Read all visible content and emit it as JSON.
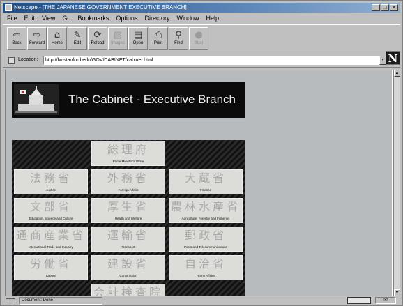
{
  "window": {
    "title": "Netscape - [THE JAPANESE GOVERNMENT EXECUTIVE BRANCH]",
    "controls": {
      "minimize": "_",
      "maximize": "□",
      "close": "×"
    }
  },
  "menu": [
    "File",
    "Edit",
    "View",
    "Go",
    "Bookmarks",
    "Options",
    "Directory",
    "Window",
    "Help"
  ],
  "toolbar": [
    {
      "label": "Back",
      "icon": "⇦",
      "enabled": true
    },
    {
      "label": "Forward",
      "icon": "⇨",
      "enabled": true
    },
    {
      "label": "Home",
      "icon": "⌂",
      "enabled": true
    },
    {
      "label": "Edit",
      "icon": "✎",
      "enabled": true
    },
    {
      "label": "Reload",
      "icon": "⟳",
      "enabled": true
    },
    {
      "label": "Images",
      "icon": "▨",
      "enabled": false
    },
    {
      "label": "Open",
      "icon": "▤",
      "enabled": true
    },
    {
      "label": "Print",
      "icon": "⎙",
      "enabled": true
    },
    {
      "label": "Find",
      "icon": "⚲",
      "enabled": true
    },
    {
      "label": "Stop",
      "icon": "●",
      "enabled": false
    }
  ],
  "location": {
    "label": "Location:",
    "url": "http://fw.stanford.edu/GOV/CABINET/cabinet.html",
    "dropdown": "▾"
  },
  "brand_logo": "N",
  "banner": {
    "title": "The Cabinet - Executive Branch"
  },
  "ministries": [
    {
      "kanji": "総理府",
      "name": "Prime Minister's Office"
    },
    {
      "kanji": "法務省",
      "name": "Justice"
    },
    {
      "kanji": "外務省",
      "name": "Foreign Affairs"
    },
    {
      "kanji": "大蔵省",
      "name": "Finance"
    },
    {
      "kanji": "文部省",
      "name": "Education, Science and Culture"
    },
    {
      "kanji": "厚生省",
      "name": "Health and Welfare"
    },
    {
      "kanji": "農林水産省",
      "name": "Agriculture, Forestry and Fisheries"
    },
    {
      "kanji": "通商産業省",
      "name": "International Trade and Industry"
    },
    {
      "kanji": "運輸省",
      "name": "Transport"
    },
    {
      "kanji": "郵政省",
      "name": "Posts and Telecommunications"
    },
    {
      "kanji": "労働省",
      "name": "Labour"
    },
    {
      "kanji": "建設省",
      "name": "Construction"
    },
    {
      "kanji": "自治省",
      "name": "Home Affairs"
    },
    {
      "kanji": "会計検査院",
      "name": ""
    }
  ],
  "scrollbar": {
    "up": "▲",
    "down": "▼"
  },
  "status": {
    "text": "Document: Done",
    "mail": "✉"
  },
  "colors": {
    "titlebar": "#1f4f86",
    "chrome": "#c0c0c0",
    "banner": "#0b0b0b",
    "tile": "#dcdcd8",
    "page_bg": "#b8bbbd"
  }
}
